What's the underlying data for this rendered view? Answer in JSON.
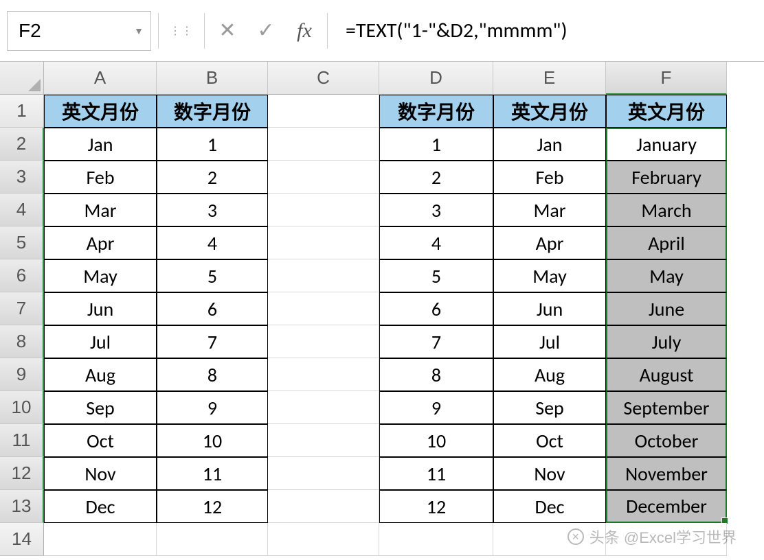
{
  "nameBox": "F2",
  "formula": "=TEXT(\"1-\"&D2,\"mmmm\")",
  "fxLabel": "fx",
  "columns": [
    "A",
    "B",
    "C",
    "D",
    "E",
    "F"
  ],
  "rowNumbers": [
    "1",
    "2",
    "3",
    "4",
    "5",
    "6",
    "7",
    "8",
    "9",
    "10",
    "11",
    "12",
    "13",
    "14"
  ],
  "headers": {
    "A": "英文月份",
    "B": "数字月份",
    "D": "数字月份",
    "E": "英文月份",
    "F": "英文月份"
  },
  "rows": [
    {
      "A": "Jan",
      "B": "1",
      "D": "1",
      "E": "Jan",
      "F": "January"
    },
    {
      "A": "Feb",
      "B": "2",
      "D": "2",
      "E": "Feb",
      "F": "February"
    },
    {
      "A": "Mar",
      "B": "3",
      "D": "3",
      "E": "Mar",
      "F": "March"
    },
    {
      "A": "Apr",
      "B": "4",
      "D": "4",
      "E": "Apr",
      "F": "April"
    },
    {
      "A": "May",
      "B": "5",
      "D": "5",
      "E": "May",
      "F": "May"
    },
    {
      "A": "Jun",
      "B": "6",
      "D": "6",
      "E": "Jun",
      "F": "June"
    },
    {
      "A": "Jul",
      "B": "7",
      "D": "7",
      "E": "Jul",
      "F": "July"
    },
    {
      "A": "Aug",
      "B": "8",
      "D": "8",
      "E": "Aug",
      "F": "August"
    },
    {
      "A": "Sep",
      "B": "9",
      "D": "9",
      "E": "Sep",
      "F": "September"
    },
    {
      "A": "Oct",
      "B": "10",
      "D": "10",
      "E": "Oct",
      "F": "October"
    },
    {
      "A": "Nov",
      "B": "11",
      "D": "11",
      "E": "Nov",
      "F": "November"
    },
    {
      "A": "Dec",
      "B": "12",
      "D": "12",
      "E": "Dec",
      "F": "December"
    }
  ],
  "watermark": "头条 @Excel学习世界",
  "selectedColumn": "F",
  "selectedRowStart": 2,
  "selectedRowEnd": 13
}
